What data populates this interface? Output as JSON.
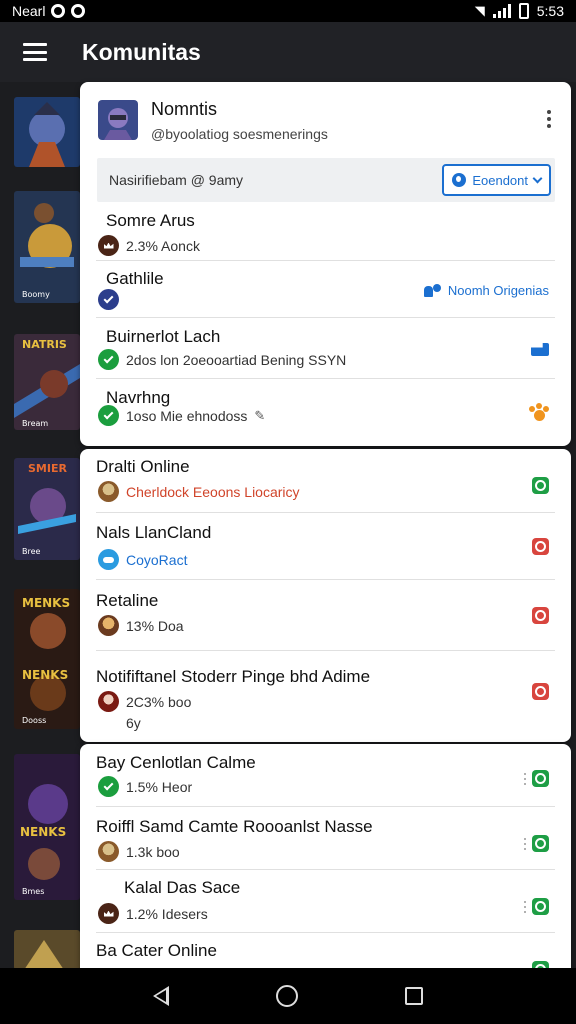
{
  "status_bar": {
    "left_text": "Nearl",
    "right_text": "5:53"
  },
  "app_bar": {
    "title": "Komunitas"
  },
  "profile": {
    "name": "Nomntis",
    "handle": "@byoolatiog soesmenerings"
  },
  "filter": {
    "label": "Nasirifiebam @ 9amy",
    "dropdown_label": "Eoendont"
  },
  "card1_rows": [
    {
      "title": "Somre Arus",
      "sub": "2.3% Aonck",
      "icon": "crown-icon"
    },
    {
      "title": "Gathlile",
      "sub": "",
      "icon": "check-icon",
      "right_text": "Noomh Origenias"
    },
    {
      "title": "Buirnerlot Lach",
      "sub": "2dos lon 2oeooartiad Bening SSYN",
      "sub_accent": "2dos lon",
      "icon": "check-icon"
    },
    {
      "title": "Navrhng",
      "sub": "1oso Mie ehnodoss",
      "icon": "check-icon"
    }
  ],
  "card2_rows": [
    {
      "title": "Dralti Online",
      "sub": "Cherldock Eeoons Liocaricy"
    },
    {
      "title": "Nals LlanCland",
      "sub": "CoyoRact"
    },
    {
      "title": "Retaline",
      "sub": "13% Doa"
    },
    {
      "title": "Notififtanel Stoderr Pinge bhd Adime",
      "sub": "2C3% boo",
      "sub2": "6y"
    }
  ],
  "card3_rows": [
    {
      "title": "Bay Cenlotlan Calme",
      "sub": "1.5% Heor"
    },
    {
      "title": "Roiffl Samd Camte Roooanlst Nasse",
      "sub": "1.3k boo"
    },
    {
      "title": "Kalal Das Sace",
      "sub": "1.2% Idesers"
    },
    {
      "title": "Ba Cater Online",
      "sub": ""
    }
  ],
  "thumbnails": [
    {
      "label": ""
    },
    {
      "label": "Boomy"
    },
    {
      "label": "NATRIS",
      "caption": "Bream"
    },
    {
      "label": "SMIER",
      "caption": "Bree"
    },
    {
      "label": "MENKS",
      "caption": "Dooss"
    },
    {
      "label": "NENKS",
      "caption": "Bmes"
    },
    {
      "label": ""
    }
  ],
  "colors": {
    "accent_blue": "#1b6fd0",
    "green": "#1e9e45",
    "red": "#d8453e",
    "orange": "#d0442a"
  }
}
